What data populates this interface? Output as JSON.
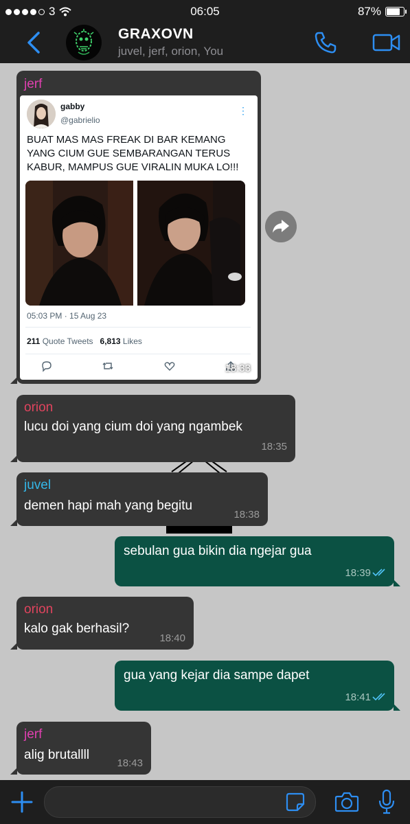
{
  "status_bar": {
    "carrier": "3",
    "time": "06:05",
    "battery": "87%",
    "battery_level": 0.87
  },
  "header": {
    "title": "GRAXOVN",
    "subtitle": "juvel, jerf, orion, You"
  },
  "tweet": {
    "sender": "jerf",
    "sender_color": "#e040b0",
    "user_name": "gabby",
    "user_handle": "@gabrielio",
    "text": "BUAT MAS MAS FREAK DI BAR KEMANG YANG CIUM GUE SEMBARANGAN TERUS KABUR, MAMPUS GUE VIRALIN MUKA LO!!!",
    "date": "05:03 PM · 15 Aug 23",
    "quote_count": "211",
    "quote_label": "Quote Tweets",
    "likes_count": "6,813",
    "likes_label": "Likes",
    "time": "18:33"
  },
  "messages": [
    {
      "sender": "orion",
      "sender_color": "#e0445e",
      "text": "lucu doi yang cium doi yang ngambek",
      "time": "18:35",
      "direction": "in"
    },
    {
      "sender": "juvel",
      "sender_color": "#34b7e8",
      "text": "demen hapi mah yang begitu",
      "time": "18:38",
      "direction": "in"
    },
    {
      "text": "sebulan gua bikin dia ngejar gua",
      "time": "18:39",
      "direction": "out",
      "status": "read"
    },
    {
      "sender": "orion",
      "sender_color": "#e0445e",
      "text": "kalo gak berhasil?",
      "time": "18:40",
      "direction": "in"
    },
    {
      "text": "gua yang kejar dia sampe dapet",
      "time": "18:41",
      "direction": "out",
      "status": "read"
    },
    {
      "sender": "jerf",
      "sender_color": "#e040b0",
      "text": "alig brutallll",
      "time": "18:43",
      "direction": "in"
    }
  ],
  "colors": {
    "accent": "#2d8ef2",
    "incoming_bubble": "#353535",
    "outgoing_bubble": "#0b5143",
    "background": "#c6c6c6",
    "bar": "#1e1e1e"
  },
  "icons": [
    "back-icon",
    "group-avatar",
    "call-icon",
    "video-call-icon",
    "forward-icon",
    "plus-icon",
    "sticker-icon",
    "camera-icon",
    "microphone-icon",
    "double-check-icon"
  ]
}
